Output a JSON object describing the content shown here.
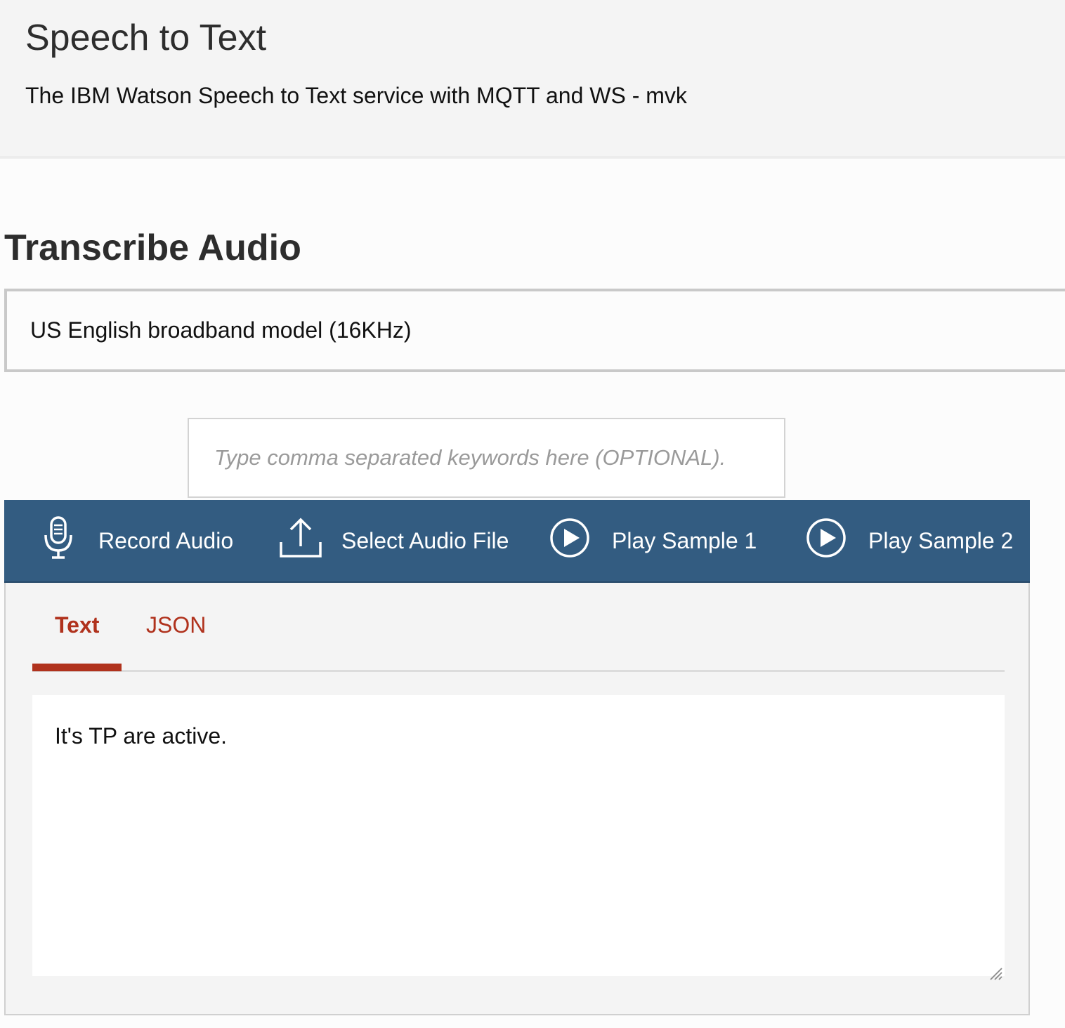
{
  "header": {
    "title": "Speech to Text",
    "subtitle": "The IBM Watson Speech to Text service with MQTT and WS - mvk"
  },
  "section": {
    "title": "Transcribe Audio"
  },
  "model_select": {
    "selected": "US English broadband model (16KHz)"
  },
  "keywords": {
    "value": "",
    "placeholder": "Type comma separated keywords here (OPTIONAL)."
  },
  "toolbar": {
    "background": "#335c81",
    "buttons": [
      {
        "label": "Record Audio",
        "icon": "microphone-icon"
      },
      {
        "label": "Select Audio File",
        "icon": "upload-icon"
      },
      {
        "label": "Play Sample 1",
        "icon": "play-circle-icon"
      },
      {
        "label": "Play Sample 2",
        "icon": "play-circle-icon"
      }
    ]
  },
  "tabs": {
    "accent": "#b0321d",
    "items": [
      {
        "label": "Text",
        "active": true
      },
      {
        "label": "JSON",
        "active": false
      }
    ]
  },
  "output": {
    "text": "It's TP are active."
  }
}
